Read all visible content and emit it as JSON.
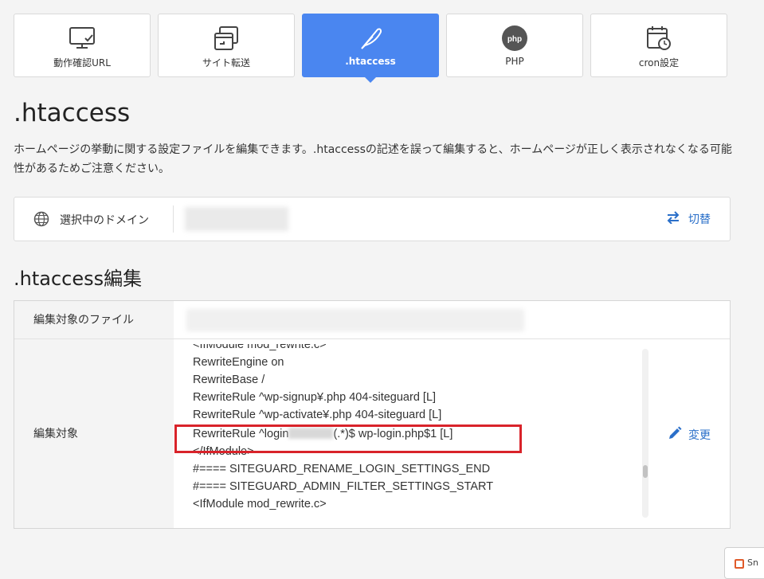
{
  "tabs": [
    {
      "label": "動作確認URL",
      "icon": "monitor-check-icon",
      "active": false
    },
    {
      "label": "サイト転送",
      "icon": "site-transfer-icon",
      "active": false
    },
    {
      "label": ".htaccess",
      "icon": "feather-icon",
      "active": true
    },
    {
      "label": "PHP",
      "icon": "php-icon",
      "active": false
    },
    {
      "label": "cron設定",
      "icon": "calendar-clock-icon",
      "active": false
    }
  ],
  "page": {
    "title": ".htaccess",
    "description": "ホームページの挙動に関する設定ファイルを編集できます。.htaccessの記述を誤って編集すると、ホームページが正しく表示されなくなる可能性があるためご注意ください。"
  },
  "domain": {
    "label": "選択中のドメイン",
    "switch_label": "切替"
  },
  "edit": {
    "title": ".htaccess編集",
    "file_label": "編集対象のファイル",
    "target_label": "編集対象",
    "change_label": "変更",
    "code_lines": [
      "<IfModule mod_rewrite.c>",
      "RewriteEngine on",
      "RewriteBase /",
      "RewriteRule ^wp-signup¥.php 404-siteguard [L]",
      "RewriteRule ^wp-activate¥.php 404-siteguard [L]",
      "RewriteRule ^login",
      "(.*)$ wp-login.php$1 [L]",
      "</IfModule>",
      "#==== SITEGUARD_RENAME_LOGIN_SETTINGS_END",
      "#==== SITEGUARD_ADMIN_FILTER_SETTINGS_START",
      "<IfModule mod_rewrite.c>"
    ]
  },
  "corner_popup": {
    "text": "Sn"
  },
  "colors": {
    "accent": "#4a86f0",
    "link": "#2a6fc9",
    "highlight": "#d9232a"
  }
}
